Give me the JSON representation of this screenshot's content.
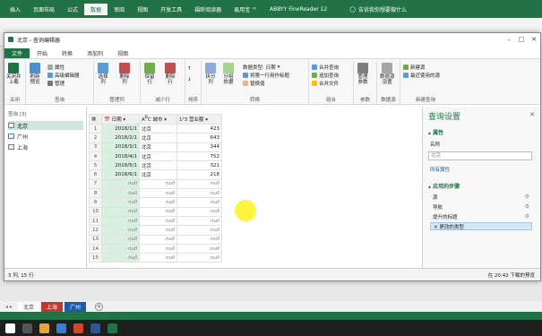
{
  "excel": {
    "tabs": [
      {
        "label": "插入",
        "active": false
      },
      {
        "label": "页面布局",
        "active": false
      },
      {
        "label": "公式",
        "active": false
      },
      {
        "label": "数据",
        "active": true
      },
      {
        "label": "审阅",
        "active": false
      },
      {
        "label": "视图",
        "active": false
      },
      {
        "label": "开发工具",
        "active": false
      },
      {
        "label": "福昕阅读器",
        "active": false
      },
      {
        "label": "易用宝 ™",
        "active": false
      },
      {
        "label": "ABBYY FineReader 12",
        "active": false
      }
    ],
    "tell_me": "告诉我你想要做什么",
    "sheets": [
      "北京",
      "上海",
      "广州"
    ],
    "sheet_colors": [
      "#ffffff",
      "#c0392b",
      "#1e5aa8"
    ]
  },
  "pq": {
    "title": "北京 - 查询编辑器",
    "tabs": [
      "文件",
      "开始",
      "转换",
      "添加列",
      "视图"
    ],
    "ribbon": {
      "close_load": "关闭并\n上载",
      "refresh_preview": "刷新\n预览",
      "properties": "属性",
      "advanced_editor": "高级编辑器",
      "manage": "管理",
      "choose_columns": "选择\n列",
      "remove_columns": "删除\n列",
      "keep_rows": "保留\n行",
      "remove_rows": "删除\n行",
      "sort_asc": "升序",
      "sort_desc": "降序",
      "split_column": "拆分\n列",
      "group_by": "分组\n依据",
      "data_type": "数据类型: 日期",
      "first_row_header": "将第一行用作标题",
      "replace_values": "替换值",
      "merge_queries": "合并查询",
      "append_queries": "追加查询",
      "combine_files": "合并文件",
      "manage_params": "管理\n参数",
      "data_source_settings": "数据源\n设置",
      "new_source": "新建源",
      "recent_sources": "最近使用的源",
      "groups": {
        "close": "关闭",
        "query": "查询",
        "manage_columns": "管理列",
        "reduce_rows": "减少行",
        "sort": "排序",
        "transform": "转换",
        "combine": "组合",
        "parameters": "参数",
        "data_source": "数据源",
        "new_query": "新建查询"
      }
    },
    "queries_label": "查询 [3]",
    "queries": [
      {
        "name": "北京",
        "selected": true
      },
      {
        "name": "广州",
        "selected": false
      },
      {
        "name": "上海",
        "selected": false
      }
    ],
    "columns": [
      "日期",
      "城市",
      "营业额"
    ],
    "rows": [
      {
        "n": "1",
        "date": "2018/1/1",
        "city": "北京",
        "sales": "423"
      },
      {
        "n": "2",
        "date": "2018/2/1",
        "city": "北京",
        "sales": "643"
      },
      {
        "n": "3",
        "date": "2018/3/1",
        "city": "北京",
        "sales": "344"
      },
      {
        "n": "4",
        "date": "2018/4/1",
        "city": "北京",
        "sales": "752"
      },
      {
        "n": "5",
        "date": "2018/5/1",
        "city": "北京",
        "sales": "321"
      },
      {
        "n": "6",
        "date": "2018/6/1",
        "city": "北京",
        "sales": "218"
      },
      {
        "n": "7",
        "date": "null",
        "city": "null",
        "sales": "null"
      },
      {
        "n": "8",
        "date": "null",
        "city": "null",
        "sales": "null"
      },
      {
        "n": "9",
        "date": "null",
        "city": "null",
        "sales": "null"
      },
      {
        "n": "10",
        "date": "null",
        "city": "null",
        "sales": "null"
      },
      {
        "n": "11",
        "date": "null",
        "city": "null",
        "sales": "null"
      },
      {
        "n": "12",
        "date": "null",
        "city": "null",
        "sales": "null"
      },
      {
        "n": "13",
        "date": "null",
        "city": "null",
        "sales": "null"
      },
      {
        "n": "14",
        "date": "null",
        "city": "null",
        "sales": "null"
      },
      {
        "n": "15",
        "date": "null",
        "city": "null",
        "sales": "null"
      }
    ],
    "settings": {
      "title": "查询设置",
      "properties_header": "▴ 属性",
      "name_label": "名称",
      "name_value": "北京",
      "all_properties": "所有属性",
      "steps_header": "▴ 应用的步骤",
      "steps": [
        {
          "label": "源",
          "selected": false,
          "gear": true
        },
        {
          "label": "导航",
          "selected": false,
          "gear": true
        },
        {
          "label": "提升的标题",
          "selected": false,
          "gear": true
        },
        {
          "label": "✕ 更改的类型",
          "selected": true,
          "gear": false
        }
      ]
    },
    "status_left": "3 列, 15 行",
    "status_right": "在 20:42 下载的预览"
  },
  "colors": {
    "excel_green": "#217346",
    "grid_highlight": "#d9efdf",
    "cursor_highlight": "#fff000"
  }
}
